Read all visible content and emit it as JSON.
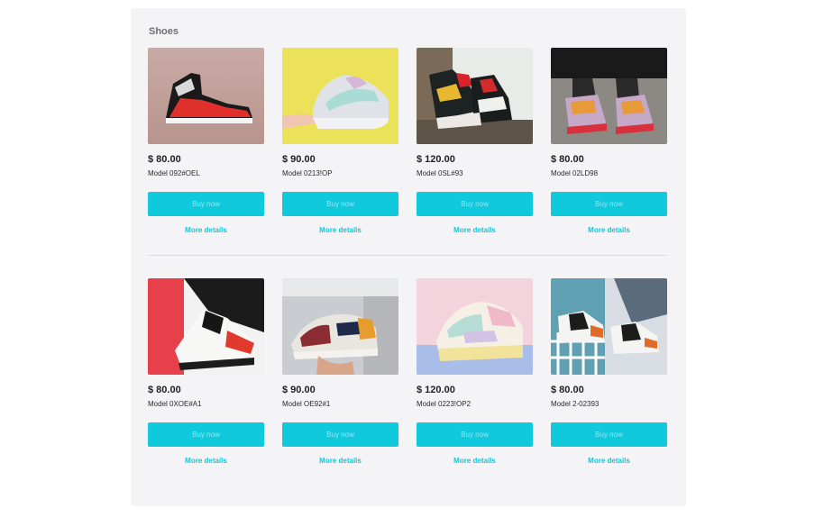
{
  "section": {
    "title": "Shoes"
  },
  "colors": {
    "accent": "#11c9dd",
    "panel": "#f4f3f6",
    "link": "#14c4d8"
  },
  "products": [
    {
      "price": "$ 80.00",
      "model": "Model 092#OEL",
      "buy_label": "Buy now",
      "details_label": "More details",
      "image": "high-top-sneaker-red-black"
    },
    {
      "price": "$ 90.00",
      "model": "Model 0213!OP",
      "buy_label": "Buy now",
      "details_label": "More details",
      "image": "pastel-chunky-sneaker-yellow"
    },
    {
      "price": "$ 120.00",
      "model": "Model 0SL#93",
      "buy_label": "Buy now",
      "details_label": "More details",
      "image": "black-red-yellow-sneakers-pair"
    },
    {
      "price": "$ 80.00",
      "model": "Model 02LD98",
      "buy_label": "Buy now",
      "details_label": "More details",
      "image": "colorful-sneakers-worn"
    },
    {
      "price": "$ 80.00",
      "model": "Model 0XOE#A1",
      "buy_label": "Buy now",
      "details_label": "More details",
      "image": "red-black-white-high-top"
    },
    {
      "price": "$ 90.00",
      "model": "Model OE92#1",
      "buy_label": "Buy now",
      "details_label": "More details",
      "image": "runner-sneaker-in-hand"
    },
    {
      "price": "$ 120.00",
      "model": "Model 0223!OP2",
      "buy_label": "Buy now",
      "details_label": "More details",
      "image": "pastel-low-top-sneaker"
    },
    {
      "price": "$ 80.00",
      "model": "Model 2-02393",
      "buy_label": "Buy now",
      "details_label": "More details",
      "image": "jordan-sneakers-worn"
    }
  ]
}
